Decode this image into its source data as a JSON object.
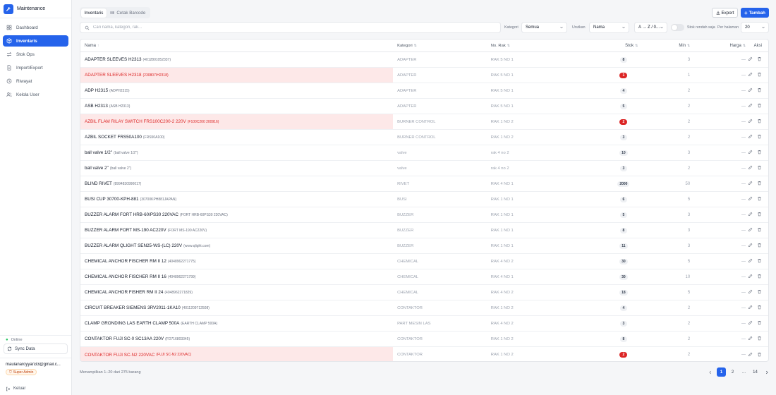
{
  "app": {
    "title": "Maintenance"
  },
  "sidebar": {
    "items": [
      {
        "label": "Dashboard",
        "icon": "dashboard-icon"
      },
      {
        "label": "Inventaris",
        "icon": "box-icon",
        "active": true
      },
      {
        "label": "Stok Ops",
        "icon": "swap-icon"
      },
      {
        "label": "Import/Export",
        "icon": "file-icon"
      },
      {
        "label": "Riwayat",
        "icon": "history-icon"
      },
      {
        "label": "Kelola User",
        "icon": "users-icon"
      }
    ],
    "status": "Online",
    "sync_label": "Sync Data",
    "user_email": "maulanaroyyan33@gmail.c...",
    "role": "Super Admin",
    "logout_label": "Keluar"
  },
  "tabs": [
    "Inventaris",
    "Cetak Barcode"
  ],
  "actions": {
    "export_label": "Export",
    "add_label": "Tambah"
  },
  "filters": {
    "search_placeholder": "Cari nama, kategori, rak...",
    "kategori_label": "Kategori",
    "kategori_value": "Semua",
    "urutkan_label": "Urutkan",
    "urutkan_value": "Nama",
    "order_value": "A → Z / 0...",
    "low_stock_label": "Stok rendah saja",
    "per_page_label": "Per halaman",
    "per_page_value": "20"
  },
  "table": {
    "columns": {
      "name": "Nama",
      "category": "Kategori",
      "rak": "No. Rak",
      "stok": "Stok",
      "min": "Min",
      "harga": "Harga",
      "aksi": "Aksi"
    },
    "rows": [
      {
        "name": "ADAPTER SLEEVES H2313",
        "code": "(4012801052337)",
        "category": "ADAPTER",
        "rak": "RAK 5 NO 1",
        "stok": "8",
        "min": "3",
        "harga": "—",
        "low": false
      },
      {
        "name": "ADAPTER SLEEVES H2318",
        "code": "(230807/H2318)",
        "category": "ADAPTER",
        "rak": "RAK 5 NO 1",
        "stok": "1",
        "min": "1",
        "harga": "—",
        "low": true
      },
      {
        "name": "ADP H2315",
        "code": "(ADPH2315)",
        "category": "ADAPTER",
        "rak": "RAK 5 NO 1",
        "stok": "4",
        "min": "2",
        "harga": "—",
        "low": false
      },
      {
        "name": "ASB H2313",
        "code": "(ASB H2313)",
        "category": "ADAPTER",
        "rak": "RAK 5 NO 1",
        "stok": "5",
        "min": "2",
        "harga": "—",
        "low": false
      },
      {
        "name": "AZBIL FLAM RILAY SWITCH FRS100C200-2 220V",
        "code": "(F100C200 200916)",
        "category": "BURNER CONTROL",
        "rak": "RAK 1 NO 2",
        "stok": "2",
        "min": "2",
        "harga": "—",
        "low": true
      },
      {
        "name": "AZBIL SOCKET FRS50A100",
        "code": "(FRS50A100)",
        "category": "BURNER CONTROL",
        "rak": "RAK 1 NO 2",
        "stok": "3",
        "min": "2",
        "harga": "—",
        "low": false
      },
      {
        "name": "ball valve 1/2''",
        "code": "(ball valve 1/2'')",
        "category": "valve",
        "rak": "rak 4 no 2",
        "stok": "10",
        "min": "3",
        "harga": "—",
        "low": false
      },
      {
        "name": "ball valve 2''",
        "code": "(ball valve 2'')",
        "category": "valve",
        "rak": "rak 4 no 2",
        "stok": "3",
        "min": "2",
        "harga": "—",
        "low": false
      },
      {
        "name": "BLIND RIVET",
        "code": "(8994830990017)",
        "category": "RIVET",
        "rak": "RAK 4 NO 1",
        "stok": "2000",
        "min": "50",
        "harga": "—",
        "low": false
      },
      {
        "name": "BUSI CUP 30700-KPH-881",
        "code": "(30700KPH881JAPAN)",
        "category": "BUSI",
        "rak": "RAK 1 NO 1",
        "stok": "6",
        "min": "5",
        "harga": "—",
        "low": false
      },
      {
        "name": "BUZZER ALARM FORT HRB-60/PS30 220VAC",
        "code": "(FORT HRB-60PS30 220VAC)",
        "category": "BUZZER",
        "rak": "RAK 1 NO 1",
        "stok": "5",
        "min": "3",
        "harga": "—",
        "low": false
      },
      {
        "name": "BUZZER ALARM FORT MS-190 AC220V",
        "code": "(FORT MS-190 AC220V)",
        "category": "BUZZER",
        "rak": "RAK 1 NO 1",
        "stok": "8",
        "min": "3",
        "harga": "—",
        "low": false
      },
      {
        "name": "BUZZER ALARM QLIGHT SEN25-WS-(LC) 220V",
        "code": "(www.qlight.com)",
        "category": "BUZZER",
        "rak": "RAK 1 NO 1",
        "stok": "11",
        "min": "3",
        "harga": "—",
        "low": false
      },
      {
        "name": "CHEMICAL ANCHOR FISCHER RM II 12",
        "code": "(4048962271775)",
        "category": "CHEMICAL",
        "rak": "RAK 4 NO 2",
        "stok": "30",
        "min": "5",
        "harga": "—",
        "low": false
      },
      {
        "name": "CHEMICAL ANCHOR FISCHER RM II 16",
        "code": "(4048962271799)",
        "category": "CHEMICAL",
        "rak": "RAK 4 NO 1",
        "stok": "30",
        "min": "10",
        "harga": "—",
        "low": false
      },
      {
        "name": "CHEMICAL ANCHOR FISHER RM II 24",
        "code": "(4048962271829)",
        "category": "CHEMICAL",
        "rak": "RAK 4 NO 2",
        "stok": "18",
        "min": "5",
        "harga": "—",
        "low": false
      },
      {
        "name": "CIRCUIT BREAKER SIEMENS 3RV2011-1KA10",
        "code": "(4011209712508)",
        "category": "CONTAKTOR",
        "rak": "RAK 1 NO 2",
        "stok": "4",
        "min": "2",
        "harga": "—",
        "low": false
      },
      {
        "name": "CLAMP GRONDING LAS EARTH CLAMP 500A",
        "code": "(EARTH CLAMP 500A)",
        "category": "PART MESIN LAS",
        "rak": "RAK 4 NO 2",
        "stok": "3",
        "min": "2",
        "harga": "—",
        "low": false
      },
      {
        "name": "CONTAKTOR FUJI SC-0 SC13AA 220V",
        "code": "(FD716803345)",
        "category": "CONTAKTOR",
        "rak": "RAK 1 NO 2",
        "stok": "8",
        "min": "2",
        "harga": "—",
        "low": false
      },
      {
        "name": "CONTAKTOR FUJI SC-N2 220VAC",
        "code": "(FUJI SC-N2 220VAC)",
        "category": "CONTAKTOR",
        "rak": "RAK 1 NO 2",
        "stok": "2",
        "min": "2",
        "harga": "—",
        "low": true
      }
    ]
  },
  "footer": {
    "summary": "Menampilkan 1–20 dari 275 barang"
  },
  "pagination": {
    "pages": [
      "1",
      "2",
      "...",
      "14"
    ],
    "current": "1"
  },
  "colors": {
    "accent": "#2563eb",
    "danger": "#dc2626",
    "low_row_bg": "#fde8e8"
  }
}
